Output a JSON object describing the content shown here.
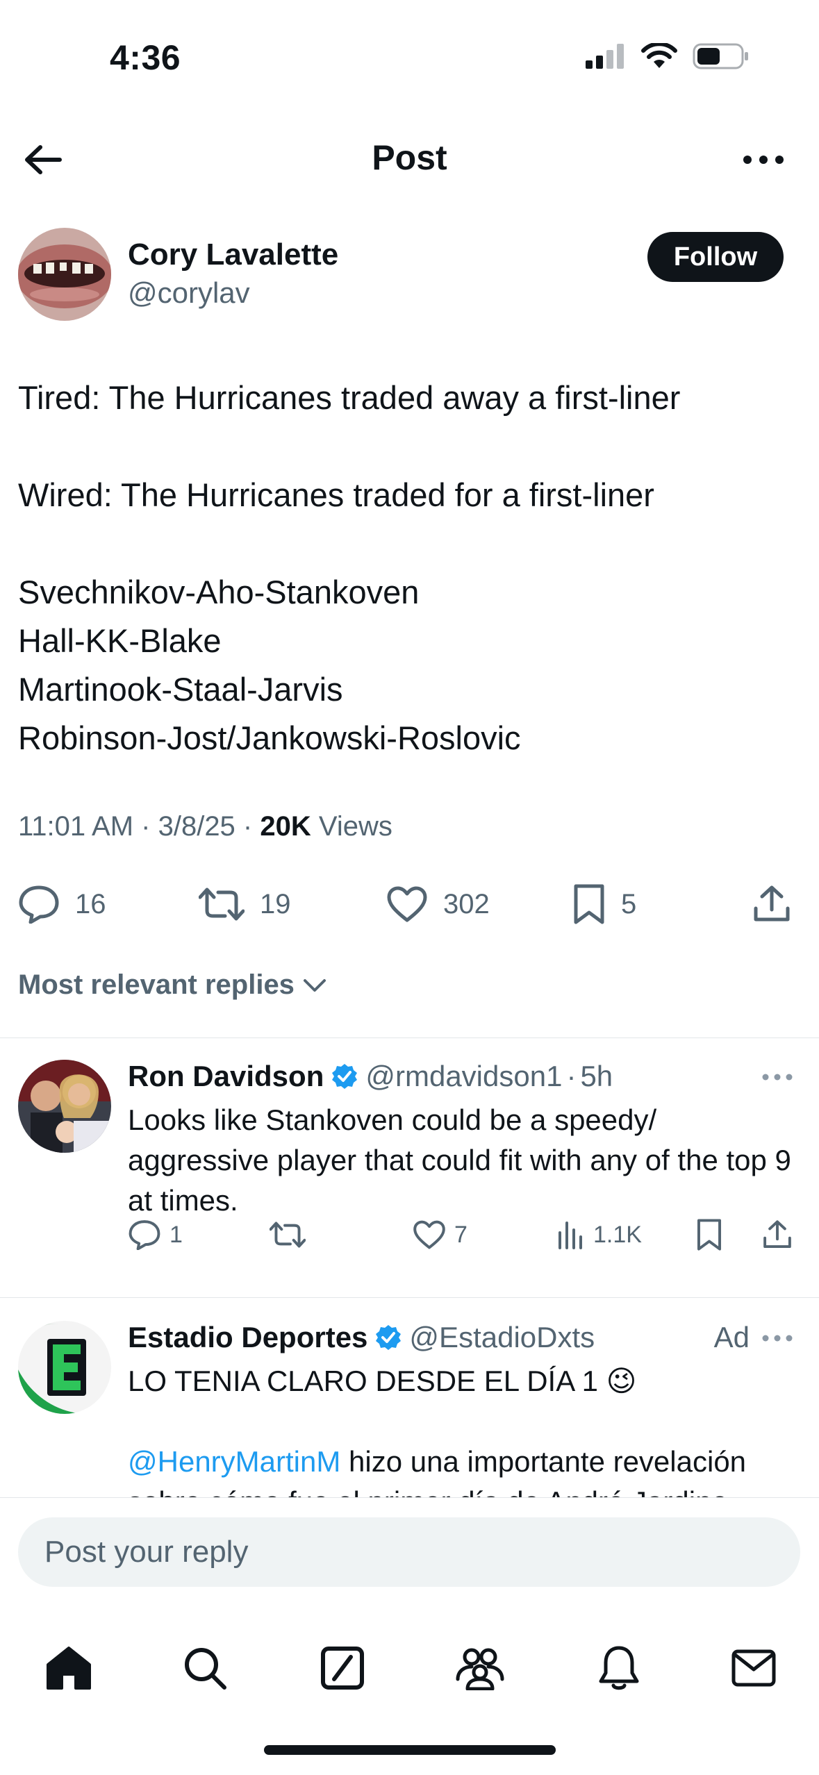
{
  "status_bar": {
    "time": "4:36"
  },
  "header": {
    "title": "Post"
  },
  "post": {
    "author_name": "Cory Lavalette",
    "author_handle": "@corylav",
    "follow_label": "Follow",
    "text_lines": [
      "Tired: The Hurricanes traded away a first-liner",
      "",
      "Wired: The Hurricanes traded for a first-liner",
      "",
      "Svechnikov-Aho-Stankoven",
      "Hall-KK-Blake",
      "Martinook-Staal-Jarvis",
      "Robinson-Jost/Jankowski-Roslovic"
    ],
    "time": "11:01 AM",
    "date": "3/8/25",
    "views_count": "20K",
    "views_label": "Views",
    "replies": "16",
    "reposts": "19",
    "likes": "302",
    "bookmarks": "5"
  },
  "sort": {
    "label": "Most relevant replies"
  },
  "replies": [
    {
      "name": "Ron Davidson",
      "handle": "@rmdavidson1",
      "age": "5h",
      "verified": true,
      "text": "Looks like Stankoven could be a speedy/ aggressive player that could fit with any of the top 9 at times.",
      "replies": "1",
      "reposts": "",
      "likes": "7",
      "views": "1.1K"
    },
    {
      "name": "Estadio Deportes",
      "handle": "@EstadioDxts",
      "verified": true,
      "ad_label": "Ad",
      "line1": "LO TENIA CLARO DESDE EL DÍA 1 😉",
      "mention": "@HenryMartinM",
      "line2": " hizo una importante revelación",
      "line3": "sobre cómo fue el primer día de André Jardine"
    }
  ],
  "composer": {
    "placeholder": "Post your reply"
  },
  "tabbar": [
    "home-icon",
    "search-icon",
    "grok-icon",
    "communities-icon",
    "notifications-icon",
    "messages-icon"
  ],
  "colors": {
    "accent": "#1d9bf0",
    "text": "#0f1419",
    "secondary": "#536471"
  }
}
